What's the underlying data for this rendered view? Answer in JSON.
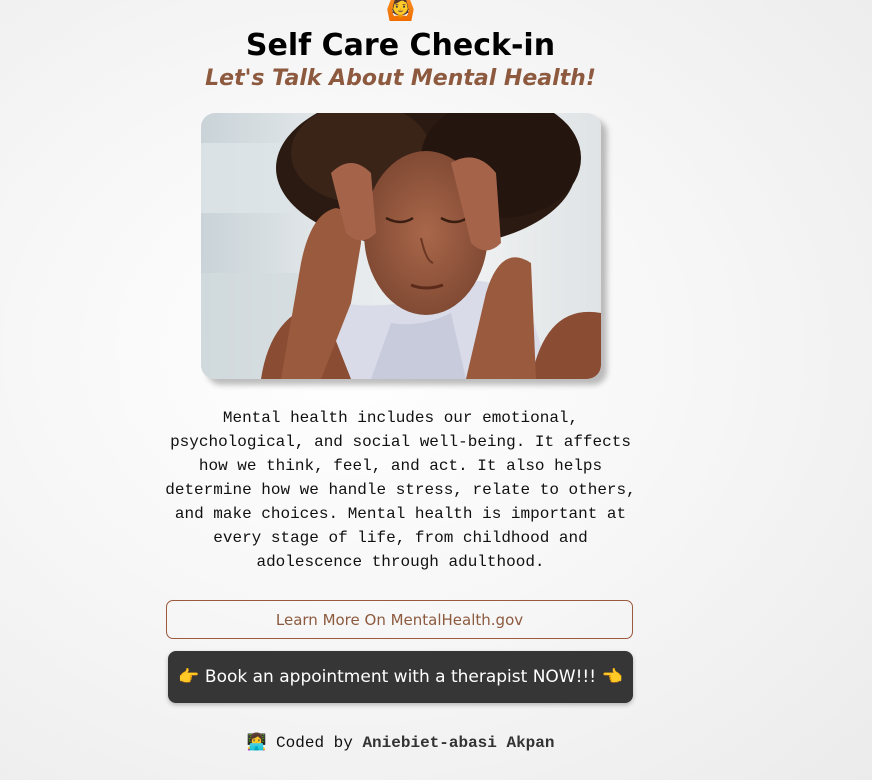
{
  "header": {
    "emoji": "🙆",
    "title": "Self Care Check-in",
    "subtitle": "Let's Talk About Mental Health!"
  },
  "hero_image": {
    "icon": "woman-holding-head-photo"
  },
  "description": "Mental health includes our emotional, psychological, and social well-being. It affects how we think, feel, and act. It also helps determine how we handle stress, relate to others, and make choices. Mental health is important at every stage of life, from childhood and adolescence through adulthood.",
  "buttons": {
    "learn_more": "Learn More On MentalHealth.gov",
    "book": "👉 Book an appointment with a therapist NOW!!! 👈"
  },
  "footer": {
    "emoji": "👩‍💻",
    "prefix": "Coded by",
    "author": "Aniebiet-abasi Akpan"
  },
  "colors": {
    "accent": "#8d5a3f",
    "button_dark": "#363636",
    "background": "#f4f4f4"
  }
}
